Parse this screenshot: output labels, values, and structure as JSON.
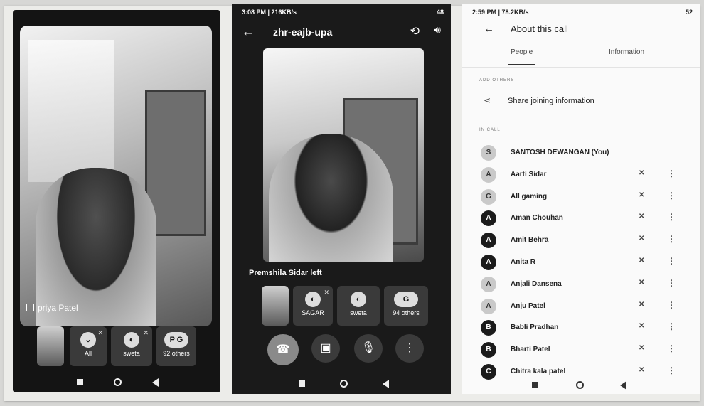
{
  "panel1": {
    "name_tag": "priya Patel",
    "tiles": [
      {
        "type": "self"
      },
      {
        "label": "All",
        "icon": "chevron-down-icon"
      },
      {
        "label": "sweta"
      },
      {
        "label": "92 others",
        "letters": "P G"
      }
    ]
  },
  "panel2": {
    "status": {
      "time": "3:08 PM | 216KB/s",
      "right": "48"
    },
    "meeting_code": "zhr-eajb-upa",
    "left_message": "Premshila Sidar left",
    "tiles": [
      {
        "type": "self"
      },
      {
        "label": "SAGAR"
      },
      {
        "label": "sweta"
      },
      {
        "label": "94 others",
        "letters": "G"
      }
    ]
  },
  "panel3": {
    "status": {
      "time": "2:59 PM | 78.2KB/s",
      "right": "52"
    },
    "title": "About this call",
    "tabs": [
      "People",
      "Information"
    ],
    "add_others_label": "ADD OTHERS",
    "share_label": "Share joining information",
    "in_call_label": "IN CALL",
    "participants": [
      {
        "name": "SANTOSH DEWANGAN (You)",
        "initial": "S",
        "style": "light",
        "self": true
      },
      {
        "name": "Aarti Sidar",
        "initial": "A",
        "style": "light"
      },
      {
        "name": "All gaming",
        "initial": "G",
        "style": "light"
      },
      {
        "name": "Aman Chouhan",
        "initial": "A",
        "style": "dark"
      },
      {
        "name": "Amit Behra",
        "initial": "A",
        "style": "dark"
      },
      {
        "name": "Anita R",
        "initial": "A",
        "style": "dark"
      },
      {
        "name": "Anjali Dansena",
        "initial": "A",
        "style": "light"
      },
      {
        "name": "Anju Patel",
        "initial": "A",
        "style": "light"
      },
      {
        "name": "Babli Pradhan",
        "initial": "B",
        "style": "dark"
      },
      {
        "name": "Bharti Patel",
        "initial": "B",
        "style": "dark"
      },
      {
        "name": "Chitra kala patel",
        "initial": "C",
        "style": "dark"
      }
    ]
  }
}
